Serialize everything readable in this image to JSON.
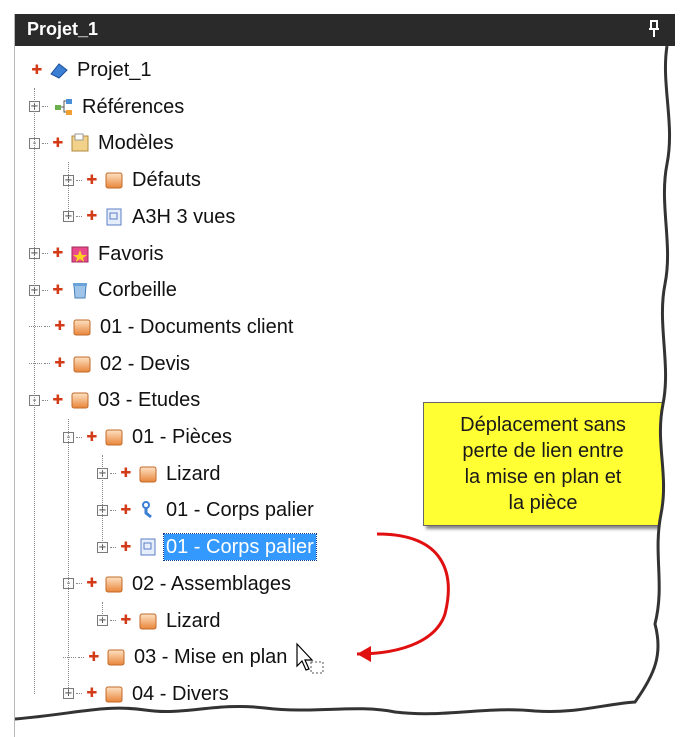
{
  "panel": {
    "title": "Projet_1",
    "pin_glyph": "ᵖ"
  },
  "tree": [
    {
      "label": "Projet_1",
      "icon": "project-icon",
      "level": 0,
      "expander": "none",
      "plus": true
    },
    {
      "label": "Références",
      "icon": "references-icon",
      "level": 0,
      "expander": "+",
      "plus": false
    },
    {
      "label": "Modèles",
      "icon": "models-folder-icon",
      "level": 0,
      "expander": "−",
      "plus": true
    },
    {
      "label": "Défauts",
      "icon": "folder-icon",
      "level": 1,
      "expander": "+",
      "plus": true
    },
    {
      "label": "A3H 3 vues",
      "icon": "drawing-icon",
      "level": 1,
      "expander": "+",
      "plus": true
    },
    {
      "label": "Favoris",
      "icon": "favorites-icon",
      "level": 0,
      "expander": "+",
      "plus": true
    },
    {
      "label": "Corbeille",
      "icon": "trash-icon",
      "level": 0,
      "expander": "+",
      "plus": true
    },
    {
      "label": "01 - Documents client",
      "icon": "folder-icon",
      "level": 0,
      "expander": "none",
      "plus": true
    },
    {
      "label": "02 - Devis",
      "icon": "folder-icon",
      "level": 0,
      "expander": "none",
      "plus": true
    },
    {
      "label": "03 - Etudes",
      "icon": "folder-icon",
      "level": 0,
      "expander": "−",
      "plus": true
    },
    {
      "label": "01 - Pièces",
      "icon": "folder-icon",
      "level": 1,
      "expander": "−",
      "plus": true
    },
    {
      "label": "Lizard",
      "icon": "folder-icon",
      "level": 2,
      "expander": "+",
      "plus": true
    },
    {
      "label": "01 - Corps palier",
      "icon": "part-icon",
      "level": 2,
      "expander": "+",
      "plus": true
    },
    {
      "label": "01 - Corps palier",
      "icon": "drawing-icon",
      "level": 2,
      "expander": "+",
      "plus": true,
      "selected": true
    },
    {
      "label": "02 - Assemblages",
      "icon": "folder-icon",
      "level": 1,
      "expander": "−",
      "plus": true
    },
    {
      "label": "Lizard",
      "icon": "folder-icon",
      "level": 2,
      "expander": "+",
      "plus": true
    },
    {
      "label": "03 - Mise en plan",
      "icon": "folder-icon",
      "level": 1,
      "expander": "none",
      "plus": true
    },
    {
      "label": "04 - Divers",
      "icon": "folder-icon",
      "level": 1,
      "expander": "+",
      "plus": true
    }
  ],
  "callout": {
    "lines": [
      "Déplacement sans",
      "perte de lien entre",
      "la mise en plan et",
      "la pièce"
    ]
  },
  "colors": {
    "selection": "#3399ff",
    "callout": "#ffff33",
    "arrow": "#e01010",
    "plus": "#d33a18"
  }
}
